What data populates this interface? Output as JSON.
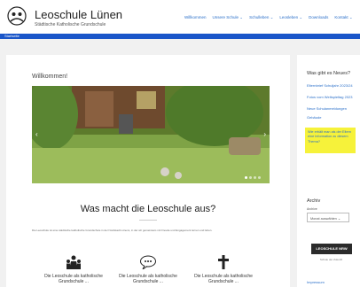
{
  "header": {
    "title": "Leoschule Lünen",
    "subtitle": "Städtische Katholische Grundschule",
    "nav": [
      "Willkommen",
      "Unsere Schule ⌄",
      "Schulleben ⌄",
      "Leosleben ⌄",
      "Downloads",
      "Kontakt ⌄"
    ]
  },
  "bluebar": {
    "label": "Startseite"
  },
  "main": {
    "welcome": "Willkommen!",
    "heading": "Was macht die Leoschule aus?",
    "intro": "Die Leoschule ist eine städtische katholische Grundschule in der Nordstadt Lünens, in der wir gemeinsam mit Freude und Engagement lernen und leben.",
    "carousel": {
      "prev": "‹",
      "next": "›",
      "slides": 4,
      "active": 0
    },
    "features": [
      {
        "label": "Die Leoschule als katholische Grundschule ...",
        "icon": "people-icon"
      },
      {
        "label": "Die Leoschule als katholische Grundschule ...",
        "icon": "speech-bubble-icon"
      },
      {
        "label": "Die Leoschule als katholische Grundschule ...",
        "icon": "cross-icon"
      }
    ]
  },
  "sidebar": {
    "title1": "Was gibt es Neues?",
    "links": [
      "Elternbrief Schuljahr 2023/24",
      "Fotos vom Weltspieltag 2023",
      "Neue Schulanmeldungen",
      "Gebäude"
    ],
    "highlight": "Wie erhält man als der Eltern eine Information zu diesem Thema?",
    "archive_title": "Archiv",
    "archive_label": "Archive",
    "archive_select": "Monat auswählen ⌄",
    "badge": "LEOSCHULE NRW",
    "badge_sub": "Schule der Zukunft",
    "bottom_link": "Impressum"
  }
}
